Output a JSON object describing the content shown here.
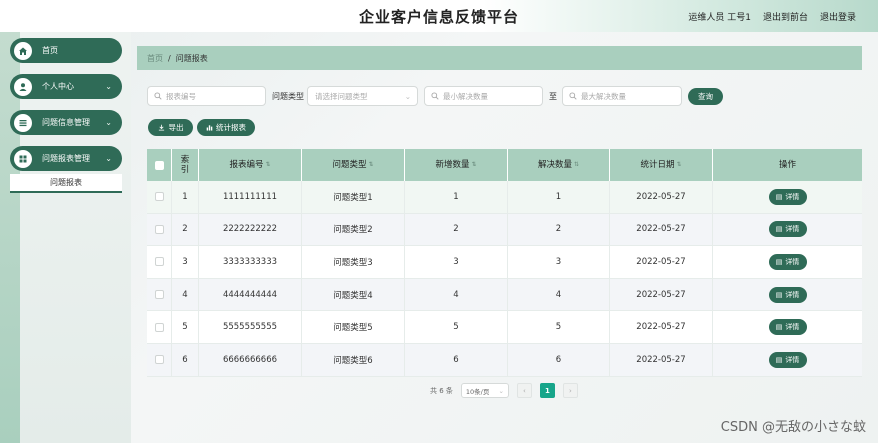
{
  "header": {
    "title": "企业客户信息反馈平台",
    "user": "运维人员 工号1",
    "go_front": "退出到前台",
    "logout": "退出登录"
  },
  "sidebar": {
    "items": [
      {
        "label": "首页",
        "icon": "home-icon",
        "has_chevron": false
      },
      {
        "label": "个人中心",
        "icon": "person-icon",
        "has_chevron": true
      },
      {
        "label": "问题信息管理",
        "icon": "list-icon",
        "has_chevron": true
      },
      {
        "label": "问题报表管理",
        "icon": "grid-icon",
        "has_chevron": true
      }
    ],
    "sub_item": "问题报表",
    "chevron": "⌄"
  },
  "breadcrumb": {
    "home": "首页",
    "sep": "/",
    "current": "问题报表"
  },
  "filters": {
    "report_no_placeholder": "报表编号",
    "type_label": "问题类型",
    "type_placeholder": "请选择问题类型",
    "min_placeholder": "最小解决数量",
    "to_label": "至",
    "max_placeholder": "最大解决数量",
    "search_button": "查询"
  },
  "actions": {
    "export": "导出",
    "stats": "统计报表"
  },
  "table": {
    "columns": [
      "索引",
      "报表编号",
      "问题类型",
      "新增数量",
      "解决数量",
      "统计日期",
      "操作"
    ],
    "rows": [
      {
        "idx": "1",
        "no": "1111111111",
        "type": "问题类型1",
        "new": "1",
        "solved": "1",
        "date": "2022-05-27"
      },
      {
        "idx": "2",
        "no": "2222222222",
        "type": "问题类型2",
        "new": "2",
        "solved": "2",
        "date": "2022-05-27"
      },
      {
        "idx": "3",
        "no": "3333333333",
        "type": "问题类型3",
        "new": "3",
        "solved": "3",
        "date": "2022-05-27"
      },
      {
        "idx": "4",
        "no": "4444444444",
        "type": "问题类型4",
        "new": "4",
        "solved": "4",
        "date": "2022-05-27"
      },
      {
        "idx": "5",
        "no": "5555555555",
        "type": "问题类型5",
        "new": "5",
        "solved": "5",
        "date": "2022-05-27"
      },
      {
        "idx": "6",
        "no": "6666666666",
        "type": "问题类型6",
        "new": "6",
        "solved": "6",
        "date": "2022-05-27"
      }
    ],
    "detail_label": "详情"
  },
  "pagination": {
    "total": "共 6 条",
    "page_size": "10条/页",
    "current_page": "1",
    "prev": "‹",
    "next": "›"
  },
  "watermark": "CSDN @无敌の小さな蚊",
  "colors": {
    "primary": "#2f6b57",
    "accent_light": "#a9cfbe",
    "page_active": "#17a58a"
  }
}
